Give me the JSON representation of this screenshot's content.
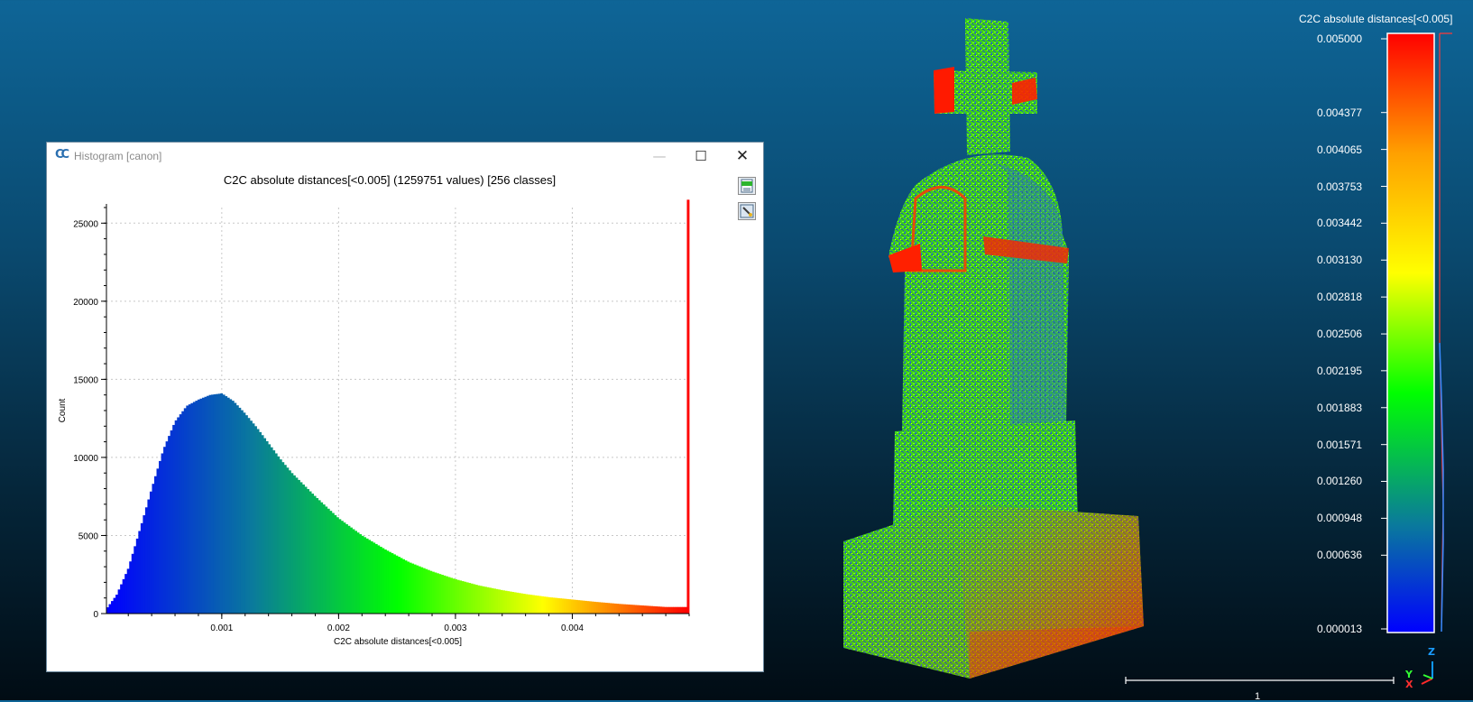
{
  "histogram_window": {
    "title": "Histogram [canon]",
    "app_icon": "CC",
    "plot_title": "C2C absolute distances[<0.005] (1259751 values)  [256 classes]",
    "buttons": {
      "minimize": "—",
      "maximize": "☐",
      "close": "✕"
    },
    "tool_icons": [
      "export-csv-icon",
      "export-image-icon"
    ]
  },
  "chart_data": {
    "type": "bar",
    "title": "C2C absolute distances[<0.005] (1259751 values)  [256 classes]",
    "xlabel": "C2C absolute distances[<0.005]",
    "ylabel": "Count",
    "xlim": [
      1.3e-05,
      0.005
    ],
    "ylim": [
      0,
      26000
    ],
    "x_ticks": [
      0.001,
      0.002,
      0.003,
      0.004
    ],
    "x_tick_labels": [
      "0.001",
      "0.002",
      "0.003",
      "0.004"
    ],
    "y_ticks": [
      0,
      5000,
      10000,
      15000,
      20000,
      25000
    ],
    "y_tick_labels": [
      "0",
      "5000",
      "10000",
      "15000",
      "20000",
      "25000"
    ],
    "grid": true,
    "bins": 256,
    "profile_points": {
      "x": [
        1.3e-05,
        0.0001,
        0.0002,
        0.0003,
        0.0004,
        0.0005,
        0.0006,
        0.0007,
        0.0008,
        0.0009,
        0.001,
        0.0011,
        0.0012,
        0.0013,
        0.0014,
        0.0015,
        0.0016,
        0.0018,
        0.002,
        0.0022,
        0.0024,
        0.0026,
        0.0028,
        0.003,
        0.0032,
        0.0034,
        0.0036,
        0.0038,
        0.004,
        0.0042,
        0.0044,
        0.0046,
        0.0048,
        0.00498,
        0.005
      ],
      "count": [
        300,
        1200,
        2900,
        5400,
        8000,
        10500,
        12300,
        13300,
        13700,
        14000,
        14100,
        13600,
        12800,
        11900,
        10900,
        9900,
        9000,
        7500,
        6100,
        5000,
        4100,
        3300,
        2700,
        2200,
        1800,
        1500,
        1250,
        1050,
        900,
        750,
        620,
        520,
        420,
        380,
        26500
      ]
    }
  },
  "scalar_field": {
    "title": "C2C absolute distances[<0.005]",
    "labels": [
      "0.005000",
      "0.004377",
      "0.004065",
      "0.003753",
      "0.003442",
      "0.003130",
      "0.002818",
      "0.002506",
      "0.002195",
      "0.001883",
      "0.001571",
      "0.001260",
      "0.000948",
      "0.000636",
      "0.000013"
    ],
    "label_values": [
      0.005,
      0.004377,
      0.004065,
      0.003753,
      0.003442,
      0.00313,
      0.002818,
      0.002506,
      0.002195,
      0.001883,
      0.001571,
      0.00126,
      0.000948,
      0.000636,
      1.3e-05
    ],
    "colors": [
      "#0000ff",
      "#0a7a9c",
      "#00ff00",
      "#ffff00",
      "#ff0000"
    ]
  },
  "scale_bar": {
    "label": "1"
  },
  "axes_trihedron": {
    "z": "Z",
    "y": "Y",
    "x": "X"
  },
  "point_cloud": {
    "object": "canon",
    "icon": "tombstone-point-cloud"
  }
}
